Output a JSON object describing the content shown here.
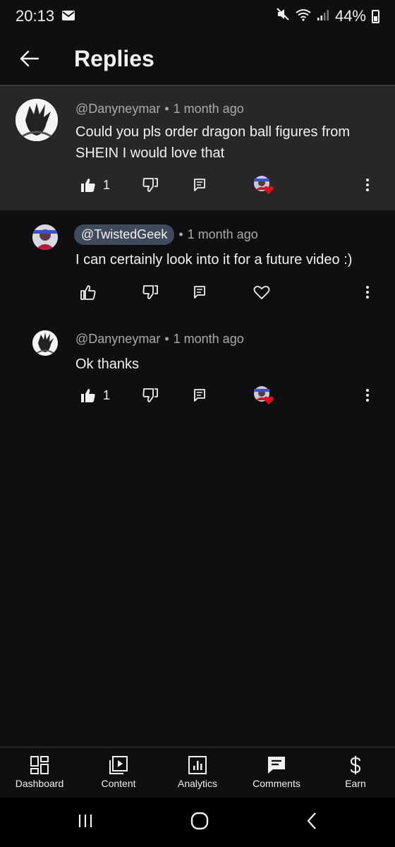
{
  "status": {
    "time": "20:13",
    "battery": "44%"
  },
  "header": {
    "title": "Replies"
  },
  "comments": [
    {
      "author": "@Danyneymar",
      "time": "1 month ago",
      "text_line1": "Could you pls order dragon ball figures from",
      "text_line2": "SHEIN I would love that",
      "likes": "1"
    },
    {
      "author": "@TwistedGeek",
      "time": "1 month ago",
      "text_line1": "I can certainly look into it for a future video :)"
    },
    {
      "author": "@Danyneymar",
      "time": "1 month ago",
      "text_line1": "Ok thanks",
      "likes": "1"
    }
  ],
  "separator": "•",
  "nav": {
    "dashboard": "Dashboard",
    "content": "Content",
    "analytics": "Analytics",
    "comments": "Comments",
    "earn": "Earn"
  },
  "colors": {
    "background": "#0f0f0f",
    "highlight": "#272727",
    "heart": "#e0101f",
    "chip": "#3f4a5a"
  }
}
